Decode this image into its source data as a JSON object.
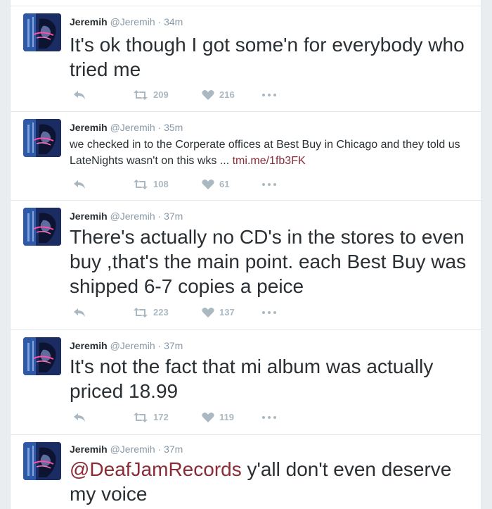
{
  "tweets": [
    {
      "name": "Jeremih",
      "handle": "@Jeremih",
      "separator": "·",
      "time": "34m",
      "text_parts": [
        "It's ok though I got some'n for everybody who tried me"
      ],
      "retweets": "209",
      "likes": "216"
    },
    {
      "name": "Jeremih",
      "handle": "@Jeremih",
      "separator": "·",
      "time": "35m",
      "text_parts": [
        "we checked in to the Corperate offices at Best Buy in Chicago and they told us LateNights  wasn't on this wks ... ",
        "tmi.me/1fb3FK"
      ],
      "retweets": "108",
      "likes": "61"
    },
    {
      "name": "Jeremih",
      "handle": "@Jeremih",
      "separator": "·",
      "time": "37m",
      "text_parts": [
        "There's actually no CD's in the stores to even buy ,that's the main point. each Best Buy was shipped 6-7 copies a peice"
      ],
      "retweets": "223",
      "likes": "137"
    },
    {
      "name": "Jeremih",
      "handle": "@Jeremih",
      "separator": "·",
      "time": "37m",
      "text_parts": [
        "It's not the fact that mi album was actually priced 18.99"
      ],
      "retweets": "172",
      "likes": "119"
    },
    {
      "name": "Jeremih",
      "handle": "@Jeremih",
      "separator": "·",
      "time": "37m",
      "text_parts": [
        "@DeafJamRecords",
        " y'all don't even deserve my voice"
      ]
    }
  ],
  "icons": {
    "avatar": "profile-avatar",
    "reply": "reply-icon",
    "retweet": "retweet-icon",
    "like": "heart-icon",
    "more": "more-icon"
  },
  "colors": {
    "text": "#292f33",
    "meta": "#8899a6",
    "action": "#aab8c2",
    "link": "#8a2b37",
    "divider": "#e1e8ed"
  }
}
